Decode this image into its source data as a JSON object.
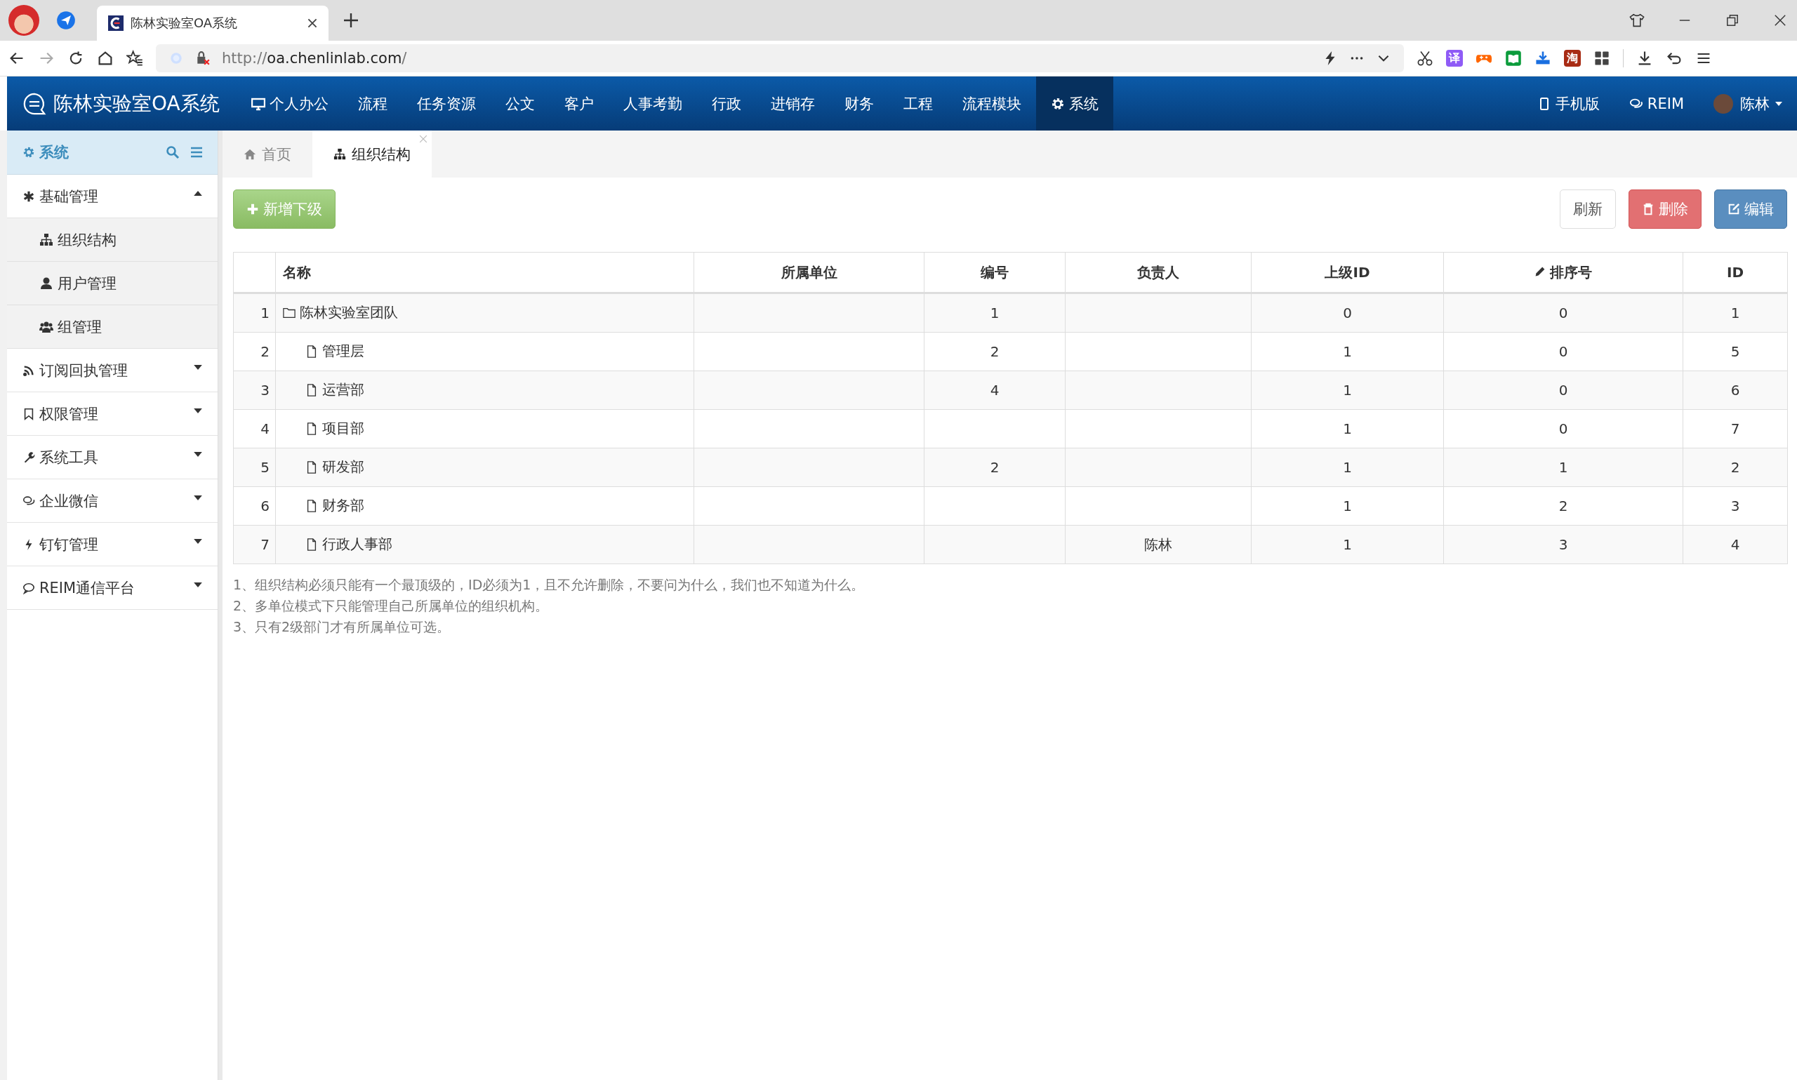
{
  "browser": {
    "tab_title": "陈林实验室OA系统",
    "url_scheme": "http://",
    "url_host": "oa.chenlinlab.com",
    "url_path": "/",
    "extensions": [
      "译",
      "淘"
    ]
  },
  "app": {
    "title": "陈林实验室OA系统",
    "menu": [
      {
        "label": "个人办公",
        "selected": false
      },
      {
        "label": "流程",
        "selected": false
      },
      {
        "label": "任务资源",
        "selected": false
      },
      {
        "label": "公文",
        "selected": false
      },
      {
        "label": "客户",
        "selected": false
      },
      {
        "label": "人事考勤",
        "selected": false
      },
      {
        "label": "行政",
        "selected": false
      },
      {
        "label": "进销存",
        "selected": false
      },
      {
        "label": "财务",
        "selected": false
      },
      {
        "label": "工程",
        "selected": false
      },
      {
        "label": "流程模块",
        "selected": false
      },
      {
        "label": "系统",
        "selected": true
      }
    ],
    "right_menu": [
      "手机版",
      "REIM",
      "陈林"
    ]
  },
  "sidebar": {
    "title": "系统",
    "groups": [
      {
        "label": "基础管理",
        "expanded": true,
        "children": [
          {
            "label": "组织结构"
          },
          {
            "label": "用户管理"
          },
          {
            "label": "组管理"
          }
        ]
      },
      {
        "label": "订阅回执管理",
        "expanded": false
      },
      {
        "label": "权限管理",
        "expanded": false
      },
      {
        "label": "系统工具",
        "expanded": false
      },
      {
        "label": "企业微信",
        "expanded": false
      },
      {
        "label": "钉钉管理",
        "expanded": false
      },
      {
        "label": "REIM通信平台",
        "expanded": false
      }
    ]
  },
  "page_tabs": [
    {
      "label": "首页",
      "selected": false,
      "closable": false
    },
    {
      "label": "组织结构",
      "selected": true,
      "closable": true
    }
  ],
  "toolbar": {
    "left": [
      {
        "label": "新增下级",
        "kind": "success"
      }
    ],
    "right": [
      {
        "label": "刷新",
        "kind": "default"
      },
      {
        "label": "删除",
        "kind": "danger"
      },
      {
        "label": "编辑",
        "kind": "primary"
      }
    ]
  },
  "table": {
    "columns": [
      "名称",
      "所属单位",
      "编号",
      "负责人",
      "上级ID",
      "排序号",
      "ID"
    ],
    "rows": [
      {
        "no": "1",
        "name": "陈林实验室团队",
        "code": "1",
        "parent_id": "0",
        "sort": "0",
        "id": "1",
        "children": [
          {
            "no": "2",
            "name": "管理层",
            "code": "2",
            "parent_id": "1",
            "sort": "0",
            "id": "5"
          },
          {
            "no": "3",
            "name": "运营部",
            "code": "4",
            "parent_id": "1",
            "sort": "0",
            "id": "6"
          },
          {
            "no": "4",
            "name": "项目部",
            "parent_id": "1",
            "sort": "0",
            "id": "7"
          },
          {
            "no": "5",
            "name": "研发部",
            "code": "2",
            "parent_id": "1",
            "sort": "1",
            "id": "2"
          },
          {
            "no": "6",
            "name": "财务部",
            "parent_id": "1",
            "sort": "2",
            "id": "3"
          },
          {
            "no": "7",
            "name": "行政人事部",
            "owner": "陈林",
            "parent_id": "1",
            "sort": "3",
            "id": "4"
          }
        ]
      }
    ]
  },
  "notes": [
    "1、组织结构必须只能有一个最顶级的，ID必须为1，且不允许删除，不要问为什么，我们也不知道为什么。",
    "2、多单位模式下只能管理自己所属单位的组织机构。",
    "3、只有2级部门才有所属单位可选。"
  ]
}
